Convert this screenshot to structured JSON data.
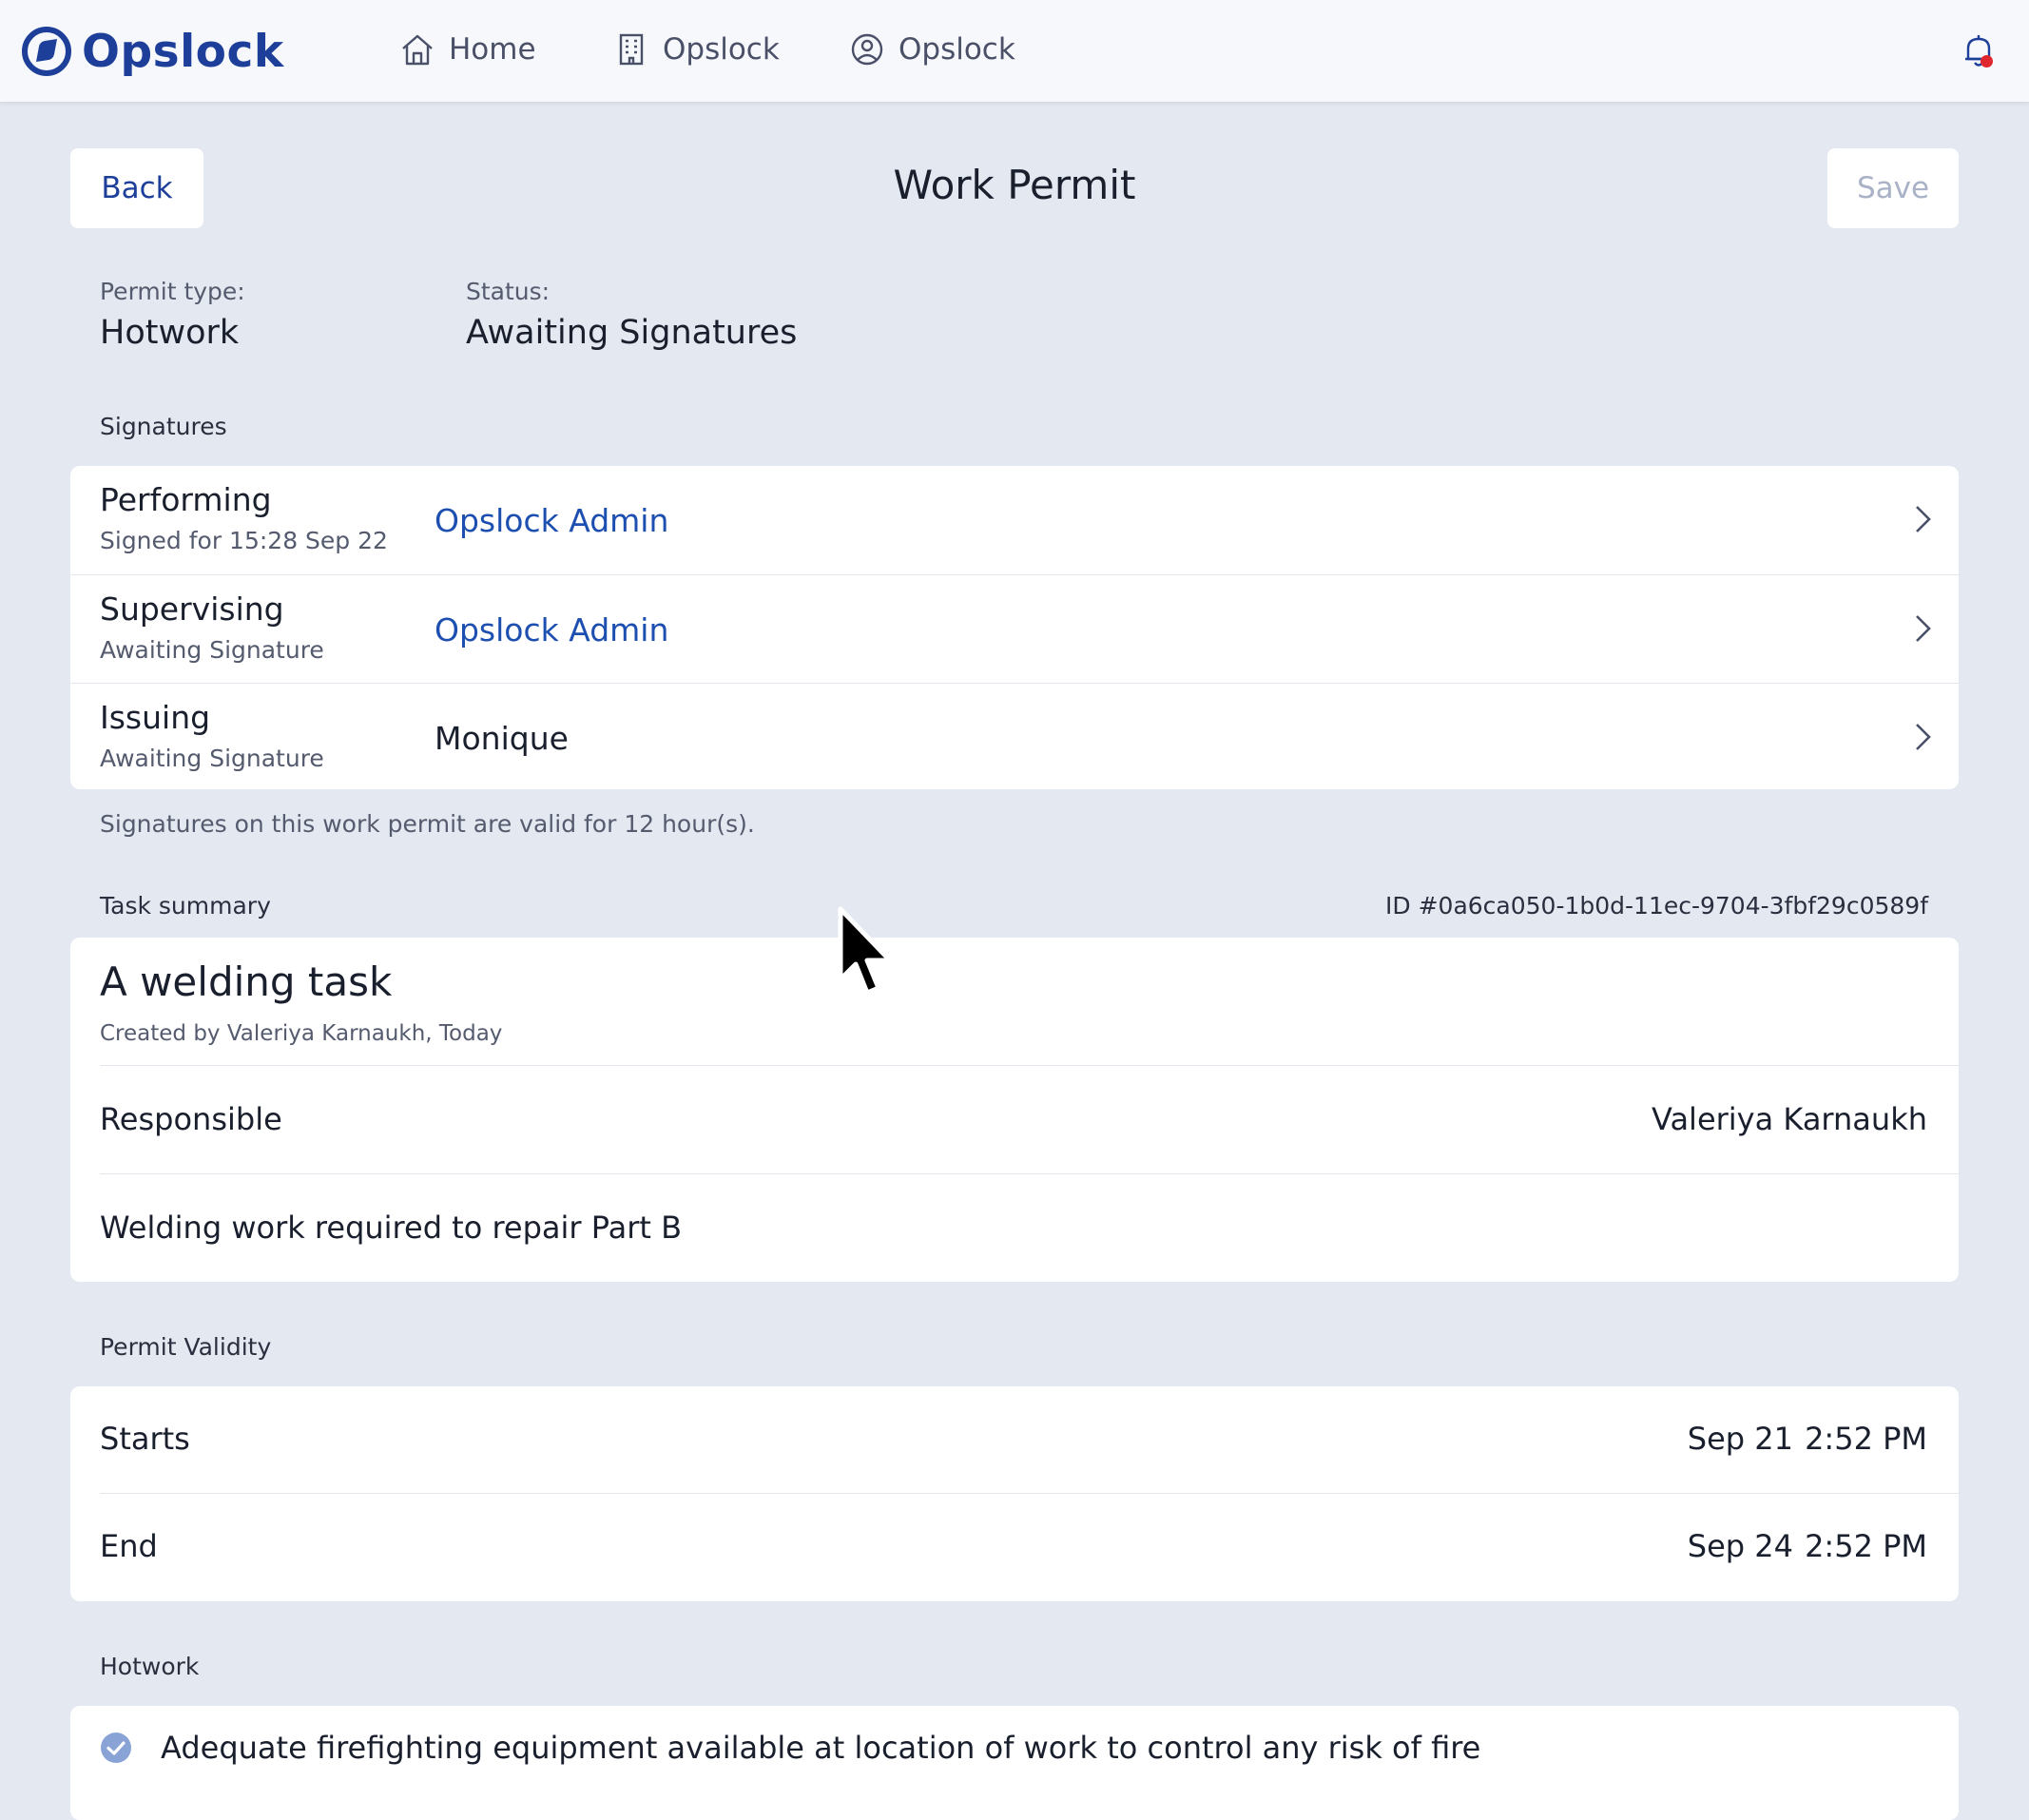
{
  "nav": {
    "logo_text": "Opslock",
    "items": [
      {
        "label": "Home",
        "icon": "home-icon"
      },
      {
        "label": "Opslock",
        "icon": "building-icon"
      },
      {
        "label": "Opslock",
        "icon": "user-circle-icon"
      }
    ],
    "notification_icon": "bell-icon",
    "notification_dot_color": "#e0262d"
  },
  "header": {
    "back_label": "Back",
    "title": "Work Permit",
    "save_label": "Save"
  },
  "permit": {
    "type_label": "Permit type:",
    "type_value": "Hotwork",
    "status_label": "Status:",
    "status_value": "Awaiting Signatures"
  },
  "signatures": {
    "section_label": "Signatures",
    "rows": [
      {
        "role": "Performing",
        "status": "Signed for 15:28 Sep 22",
        "person": "Opslock Admin"
      },
      {
        "role": "Supervising",
        "status": "Awaiting Signature",
        "person": "Opslock Admin"
      },
      {
        "role": "Issuing",
        "status": "Awaiting Signature",
        "person": "Monique"
      }
    ],
    "validity_note": "Signatures on this work permit are valid for 12 hour(s)."
  },
  "task": {
    "section_label": "Task summary",
    "id_text": "ID #0a6ca050-1b0d-11ec-9704-3fbf29c0589f",
    "title": "A welding task",
    "created": "Created by Valeriya Karnaukh, Today",
    "responsible_label": "Responsible",
    "responsible_value": "Valeriya Karnaukh",
    "description": "Welding work required to repair Part B"
  },
  "validity": {
    "section_label": "Permit Validity",
    "starts_label": "Starts",
    "starts_date": "Sep 21",
    "starts_time": "2:52 PM",
    "end_label": "End",
    "end_date": "Sep 24",
    "end_time": "2:52 PM"
  },
  "hotwork": {
    "section_label": "Hotwork",
    "items": [
      {
        "text": "Adequate firefighting equipment available at location of work to control any risk of fire",
        "checked": true
      }
    ]
  },
  "colors": {
    "brand": "#1d3f9a",
    "link": "#1d4fb0",
    "background": "#e4e8f0",
    "check": "#8aa3d6"
  }
}
